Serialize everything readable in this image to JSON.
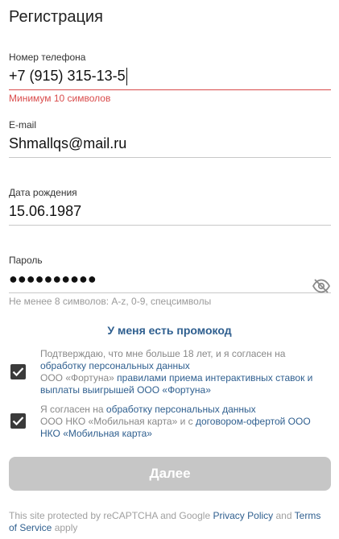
{
  "page": {
    "title": "Регистрация"
  },
  "phone": {
    "label": "Номер телефона",
    "value": "+7 (915) 315-13-5",
    "error": "Минимум 10 символов"
  },
  "email": {
    "label": "E-mail",
    "value": "Shmallqs@mail.ru"
  },
  "birthdate": {
    "label": "Дата рождения",
    "value": "15.06.1987"
  },
  "password": {
    "label": "Пароль",
    "value": "●●●●●●●●●●",
    "hint": "Не менее 8 символов: A-z, 0-9, спецсимволы",
    "toggle_icon": "eye-slash-icon"
  },
  "promo": {
    "label": "У меня есть промокод"
  },
  "consents": [
    {
      "checked": true,
      "line1": "Подтверждаю, что мне больше 18 лет, и я согласен на",
      "link1": "обработку персональных данных",
      "line2": "ООО «Фортуна»",
      "link2": "правилами приема интерактивных ставок и выплаты выигрышей ООО «Фортуна»"
    },
    {
      "checked": true,
      "line1": "Я согласен на",
      "link1": "обработку персональных данных",
      "line2": "ООО НКО «Мобильная карта» и с",
      "link2": "договором-офертой ООО НКО «Мобильная карта»"
    }
  ],
  "submit": {
    "label": "Далее"
  },
  "footer": {
    "prefix": "This site protected by reCAPTCHA and Google",
    "privacy": "Privacy Policy",
    "and": "and",
    "terms": "Terms of Service",
    "suffix": "apply"
  },
  "colors": {
    "accent": "#2f5f8f",
    "error": "#d94b4b",
    "button_disabled": "#c6c6c6",
    "checkbox": "#3a3a3a"
  }
}
